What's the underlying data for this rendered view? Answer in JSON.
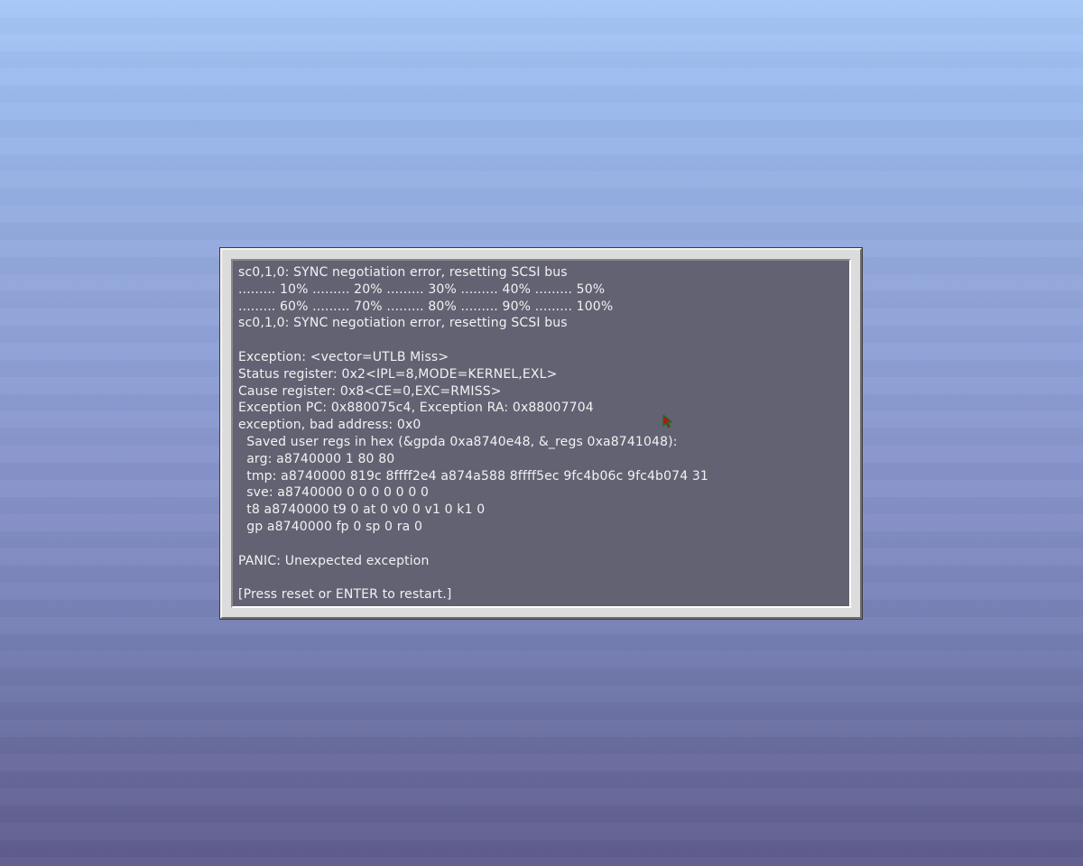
{
  "console": {
    "lines": [
      "sc0,1,0: SYNC negotiation error, resetting SCSI bus",
      "......... 10% ......... 20% ......... 30% ......... 40% ......... 50%",
      "......... 60% ......... 70% ......... 80% ......... 90% ......... 100%",
      "sc0,1,0: SYNC negotiation error, resetting SCSI bus",
      "",
      "Exception: <vector=UTLB Miss>",
      "Status register: 0x2<IPL=8,MODE=KERNEL,EXL>",
      "Cause register: 0x8<CE=0,EXC=RMISS>",
      "Exception PC: 0x880075c4, Exception RA: 0x88007704",
      "exception, bad address: 0x0",
      "  Saved user regs in hex (&gpda 0xa8740e48, &_regs 0xa8741048):",
      "  arg: a8740000 1 80 80",
      "  tmp: a8740000 819c 8ffff2e4 a874a588 8ffff5ec 9fc4b06c 9fc4b074 31",
      "  sve: a8740000 0 0 0 0 0 0 0",
      "  t8 a8740000 t9 0 at 0 v0 0 v1 0 k1 0",
      "  gp a8740000 fp 0 sp 0 ra 0",
      "",
      "PANIC: Unexpected exception",
      "",
      "[Press reset or ENTER to restart.]"
    ]
  },
  "cursor": {
    "icon": "arrow-pointer-icon",
    "fill": "#b01818",
    "outline": "#1e6e1e"
  },
  "colors": {
    "screen_bg": "#626273",
    "text": "#f2f2f2",
    "frame": "#dcdcdc"
  }
}
